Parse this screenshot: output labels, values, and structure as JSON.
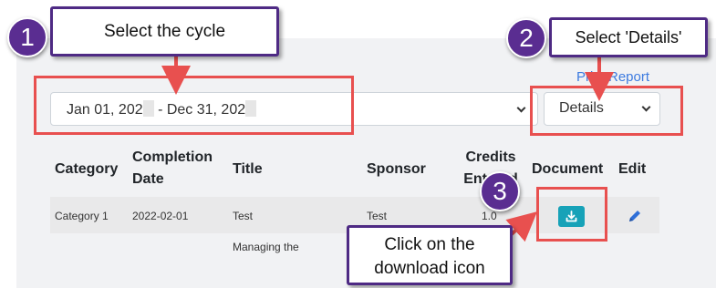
{
  "form": {
    "print_report_label": "Print Report",
    "cycle_select": {
      "start": "Jan 01, 202",
      "end": " - Dec 31, 202"
    },
    "details_select": {
      "value": "Details"
    }
  },
  "table": {
    "headers": {
      "category": "Category",
      "completion_date": [
        "Completion",
        "Date"
      ],
      "title": "Title",
      "sponsor": "Sponsor",
      "credits_entered": [
        "Credits",
        "Entered"
      ],
      "document": "Document",
      "edit": "Edit"
    },
    "rows": [
      {
        "category": "Category 1",
        "completion_date": "2022-02-01",
        "title": "Test",
        "sponsor": "Test",
        "credits": "1.0"
      },
      {
        "category": "",
        "completion_date": "",
        "title": "Managing the",
        "sponsor": "",
        "credits": ""
      }
    ]
  },
  "callouts": [
    {
      "number": "1",
      "text": "Select the cycle"
    },
    {
      "number": "2",
      "text": "Select 'Details'"
    },
    {
      "number": "3",
      "text": [
        "Click on the",
        "download icon"
      ]
    }
  ],
  "colors": {
    "callout_border": "#4e2a84",
    "badge": "#5a2d91",
    "highlight": "#e8504f",
    "download_button": "#17a2b8",
    "link": "#3d7be0"
  },
  "icons": {
    "download": "download-icon",
    "edit": "pencil-icon",
    "select_arrow": "chevron-down-icon"
  }
}
